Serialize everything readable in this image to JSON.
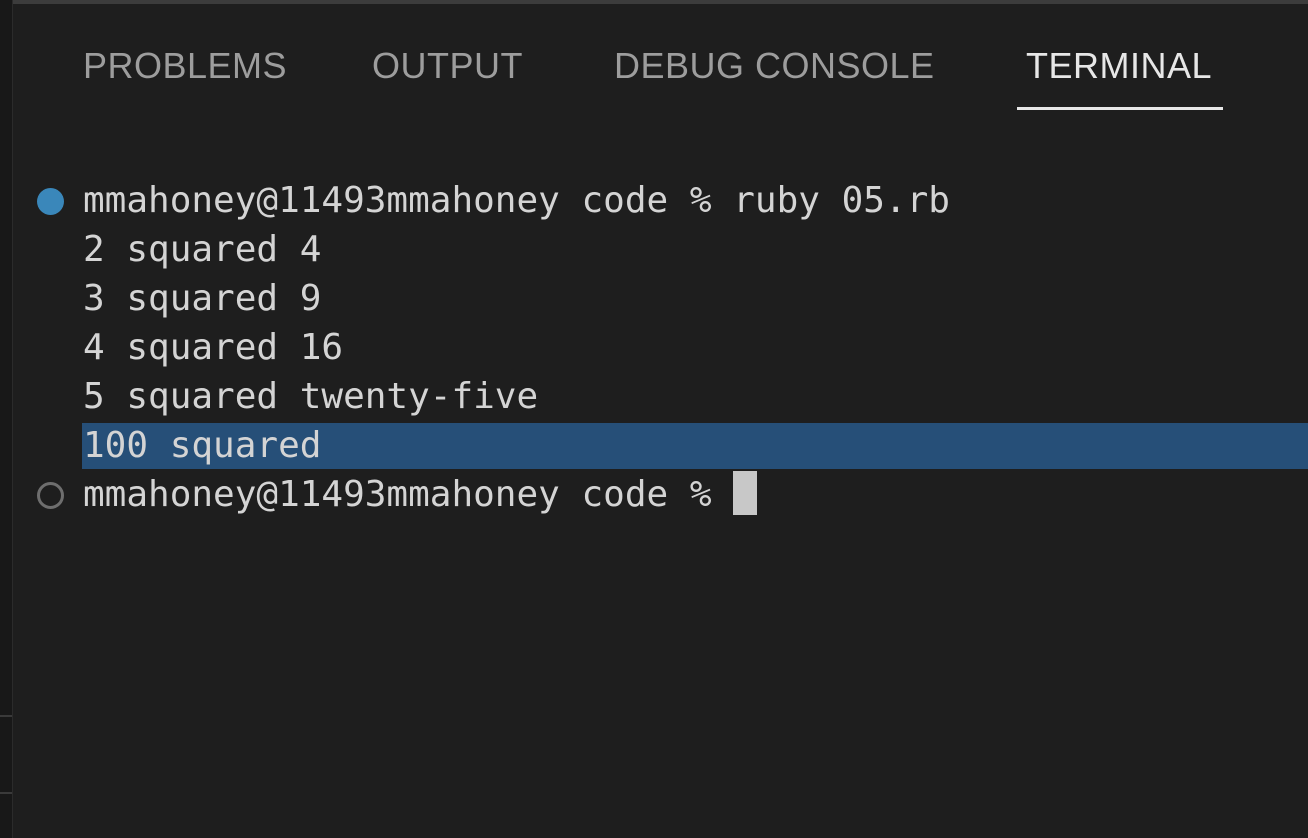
{
  "tabs": [
    {
      "label": "PROBLEMS"
    },
    {
      "label": "OUTPUT"
    },
    {
      "label": "DEBUG CONSOLE"
    },
    {
      "label": "TERMINAL",
      "active": true
    }
  ],
  "terminal": {
    "lines": [
      {
        "text": "mmahoney@11493mmahoney code % ruby 05.rb",
        "decoration": "success"
      },
      {
        "text": "2 squared 4"
      },
      {
        "text": "3 squared 9"
      },
      {
        "text": "4 squared 16"
      },
      {
        "text": "5 squared twenty-five"
      },
      {
        "text": "100 squared",
        "selected": true
      },
      {
        "text": "mmahoney@11493mmahoney code % ",
        "decoration": "default",
        "cursor": true
      }
    ]
  },
  "colors": {
    "background": "#1e1e1e",
    "selection": "#264f78",
    "success_decoration": "#3a87ba",
    "tab_active": "#e7e7e7",
    "tab_inactive": "#9d9d9d"
  }
}
